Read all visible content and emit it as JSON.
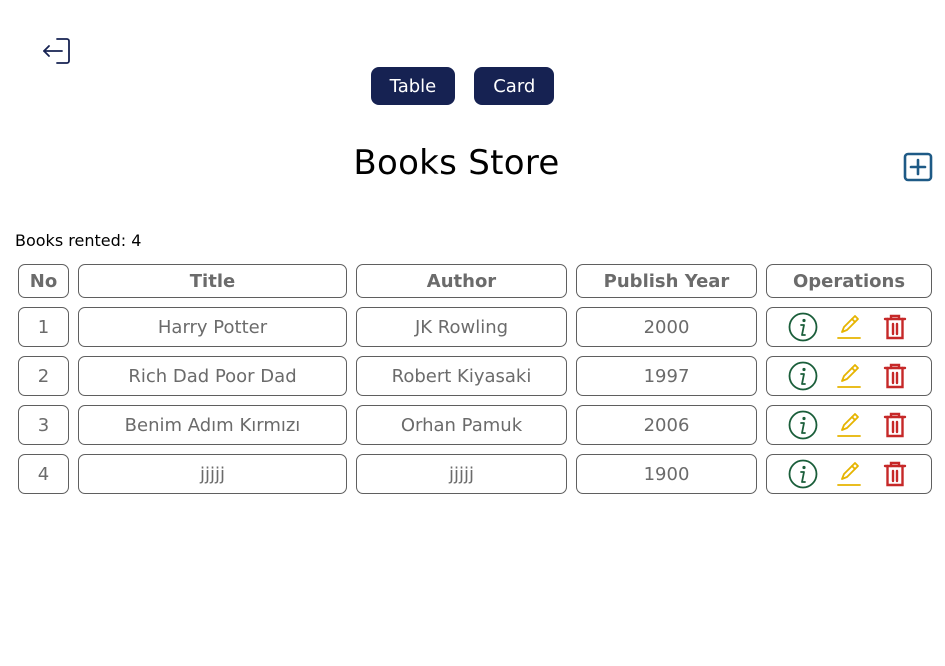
{
  "header": {
    "logout_icon": "logout-icon",
    "view_buttons": {
      "table_label": "Table",
      "card_label": "Card"
    },
    "title": "Books Store",
    "add_icon": "add-square-icon"
  },
  "summary": {
    "rented_text": "Books rented: 4"
  },
  "table": {
    "columns": [
      "No",
      "Title",
      "Author",
      "Publish Year",
      "Operations"
    ],
    "rows": [
      {
        "no": "1",
        "title": "Harry Potter",
        "author": "JK Rowling",
        "year": "2000"
      },
      {
        "no": "2",
        "title": "Rich Dad Poor Dad",
        "author": "Robert Kiyasaki",
        "year": "1997"
      },
      {
        "no": "3",
        "title": "Benim Adım Kırmızı",
        "author": "Orhan Pamuk",
        "year": "2006"
      },
      {
        "no": "4",
        "title": "jjjjj",
        "author": "jjjjj",
        "year": "1900"
      }
    ],
    "operation_icons": [
      "info-icon",
      "edit-icon",
      "delete-icon"
    ]
  },
  "colors": {
    "primary": "#162252",
    "info": "#1a5e3a",
    "edit": "#e6b400",
    "delete": "#c62828",
    "add": "#1e5a86",
    "cell_text": "#6b6b6b"
  }
}
